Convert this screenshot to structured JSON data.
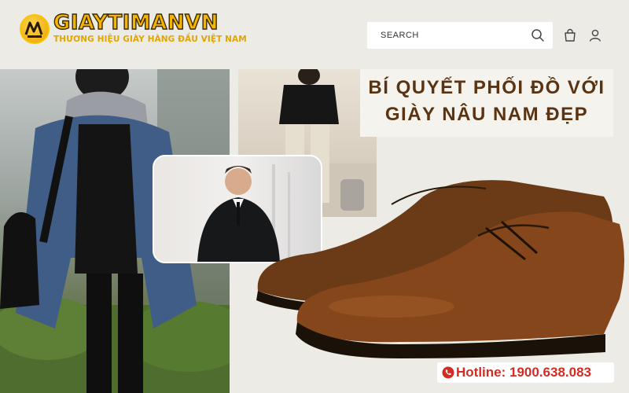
{
  "header": {
    "brand_name": "GIAYTIMANVN",
    "brand_tagline": "THƯƠNG HIỆU GIÀY HÀNG ĐẦU VIỆT NAM",
    "logo_icon": "logo-badge-icon",
    "search": {
      "placeholder": "SEARCH",
      "value": ""
    },
    "icons": [
      "search-icon",
      "cart-icon",
      "user-icon"
    ]
  },
  "banner": {
    "title_line1": "BÍ QUYẾT PHỐI ĐỒ VỚI",
    "title_line2": "GIÀY NÂU NAM ĐẸP",
    "hotline": "Hotline: 1900.638.083",
    "hotline_icon": "phone-icon"
  },
  "colors": {
    "brand_yellow": "#f7b500",
    "title_brown": "#5a3412",
    "hotline_red": "#d42b22",
    "background": "#ecebe6"
  }
}
